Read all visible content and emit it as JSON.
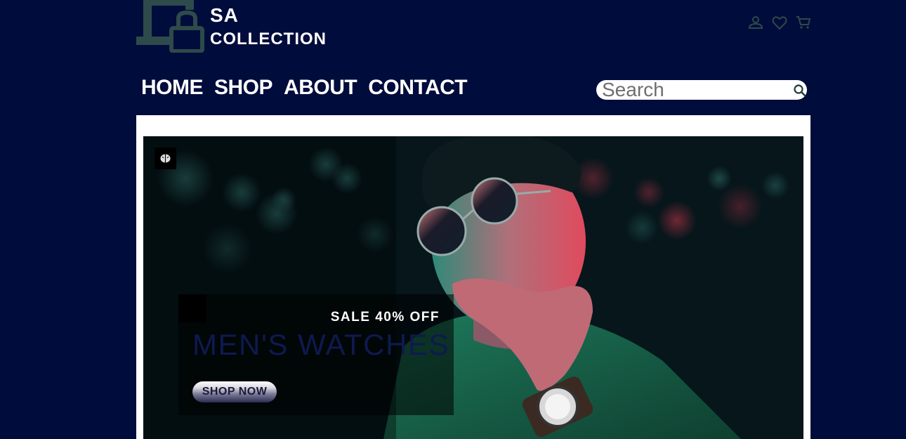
{
  "brand": {
    "line1": "SA",
    "line2": "COLLECTION",
    "logo_icon": "laptop-bag-icon",
    "logo_color": "#2e4a4a"
  },
  "header_icons": [
    {
      "name": "user-icon"
    },
    {
      "name": "heart-icon"
    },
    {
      "name": "cart-icon"
    }
  ],
  "nav": {
    "items": [
      "HOME",
      "SHOP",
      "ABOUT",
      "CONTACT"
    ]
  },
  "search": {
    "placeholder": "Search",
    "icon": "search-icon"
  },
  "hero": {
    "sale_text": "SALE 40% OFF",
    "title": "MEN'S WATCHES",
    "button_label": "SHOP NOW"
  },
  "colors": {
    "background": "#000c3b",
    "frame": "#ffffff",
    "title_text": "#0e1a4f",
    "icon_color": "#2e4a4a"
  }
}
